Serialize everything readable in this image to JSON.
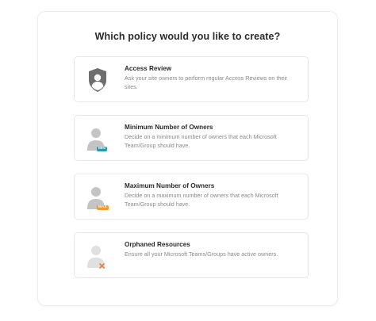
{
  "header": {
    "title": "Which policy would you like to create?"
  },
  "colors": {
    "min_badge": "#1f9eb0",
    "max_badge": "#f39a2d",
    "orphan_mark": "#f07a2a",
    "person_gray": "#c4c4c4",
    "shield_gray": "#6e6e6e"
  },
  "policies": [
    {
      "title": "Access Review",
      "description": "Ask your site owners to perform regular Access Reviews on their sites.",
      "icon": "shield-user-icon"
    },
    {
      "title": "Minimum Number of Owners",
      "description": "Decide on a minimum number of owners that each Microsoft Team/Group should have.",
      "icon": "user-min-icon",
      "badge": "MIN"
    },
    {
      "title": "Maximum Number of Owners",
      "description": "Decide on a maximum number of owners that each Microsoft Team/Group should have.",
      "icon": "user-max-icon",
      "badge": "MAX"
    },
    {
      "title": "Orphaned Resources",
      "description": "Ensure all your Microsoft Teams/Groups have active owners.",
      "icon": "user-orphan-icon"
    }
  ]
}
